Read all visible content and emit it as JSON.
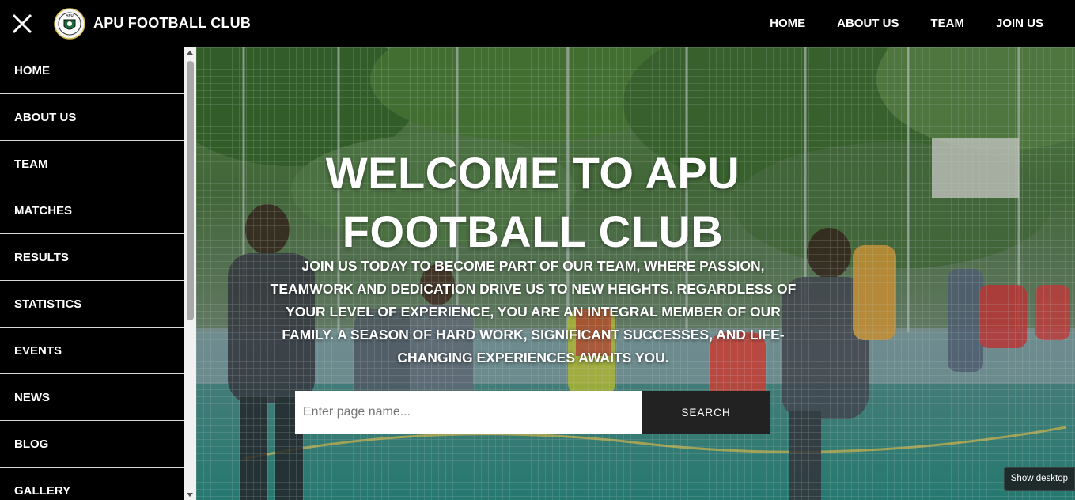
{
  "header": {
    "brand": "APU FOOTBALL CLUB",
    "nav": [
      "HOME",
      "ABOUT US",
      "TEAM",
      "JOIN US"
    ],
    "close_icon": "close-icon",
    "logo_icon": "club-crest-logo"
  },
  "sidebar": {
    "items": [
      "HOME",
      "ABOUT US",
      "TEAM",
      "MATCHES",
      "RESULTS",
      "STATISTICS",
      "EVENTS",
      "NEWS",
      "BLOG",
      "GALLERY"
    ]
  },
  "hero": {
    "title_line1": "WELCOME TO APU",
    "title_line2": "FOOTBALL CLUB",
    "text": "JOIN US TODAY TO BECOME PART OF OUR TEAM, WHERE PASSION, TEAMWORK AND DEDICATION DRIVE US TO NEW HEIGHTS. REGARDLESS OF YOUR LEVEL OF EXPERIENCE, YOU ARE AN INTEGRAL MEMBER OF OUR FAMILY. A SEASON OF HARD WORK, SIGNIFICANT SUCCESSES, AND LIFE-CHANGING EXPERIENCES AWAITS YOU.",
    "search_placeholder": "Enter page name...",
    "search_button": "SEARCH"
  },
  "tooltip": {
    "show_desktop": "Show desktop"
  },
  "colors": {
    "topbar": "#000000",
    "sidebar": "#000000",
    "search_button": "#222222",
    "court_teal": "#2f8f86",
    "foliage": "#3d6b35"
  }
}
